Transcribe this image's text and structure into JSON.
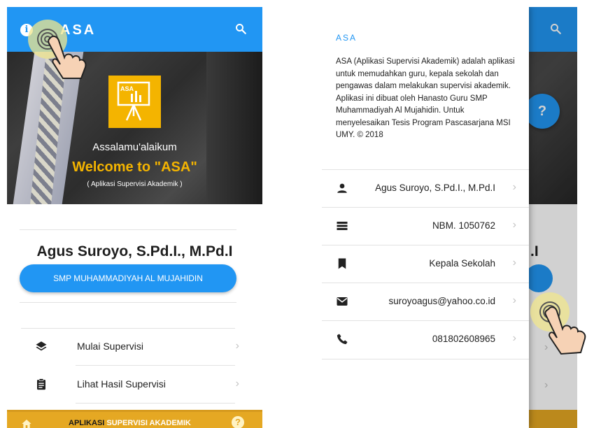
{
  "left_screen": {
    "appbar": {
      "title": "ASA",
      "info_icon": "info-icon",
      "search_icon": "search-icon",
      "color": "#2196f3"
    },
    "hero": {
      "logo_text": "ASA",
      "greeting": "Assalamu'alaikum",
      "welcome": "Welcome to \"ASA\"",
      "subtitle": "( Aplikasi Supervisi Akademik )",
      "accent": "#f4b400"
    },
    "profile": {
      "name": "Agus Suroyo, S.Pd.I., M.Pd.I",
      "school_button": "SMP MUHAMMADIYAH AL MUJAHIDIN"
    },
    "menu": [
      {
        "label": "Mulai Supervisi",
        "icon": "layers-icon"
      },
      {
        "label": "Lihat Hasil Supervisi",
        "icon": "clipboard-icon"
      }
    ],
    "bottom_bar": {
      "text_part1": "APLIKASI",
      "text_part2": "SUPERVISI AKADEMIK",
      "home_icon": "home-icon",
      "help_icon": "help-icon",
      "color": "#e5a823"
    }
  },
  "right_screen": {
    "drawer": {
      "title": "ASA",
      "description": "ASA (Aplikasi Supervisi Akademik) adalah aplikasi untuk memudahkan guru, kepala sekolah dan pengawas dalam melakukan supervisi akademik. Aplikasi ini dibuat oleh Hanasto Guru SMP Muhammadiyah Al Mujahidin. Untuk menyelesaikan Tesis Program Pascasarjana MSI UMY. © 2018",
      "items": [
        {
          "value": "Agus Suroyo, S.Pd.I., M.Pd.I",
          "icon": "person-icon"
        },
        {
          "value": "NBM. 1050762",
          "icon": "list-icon"
        },
        {
          "value": "Kepala Sekolah",
          "icon": "bookmark-icon"
        },
        {
          "value": "suroyoagus@yahoo.co.id",
          "icon": "mail-icon"
        },
        {
          "value": "081802608965",
          "icon": "phone-icon"
        }
      ]
    },
    "behind": {
      "name_fragment": ".I",
      "help_label": "?"
    }
  }
}
